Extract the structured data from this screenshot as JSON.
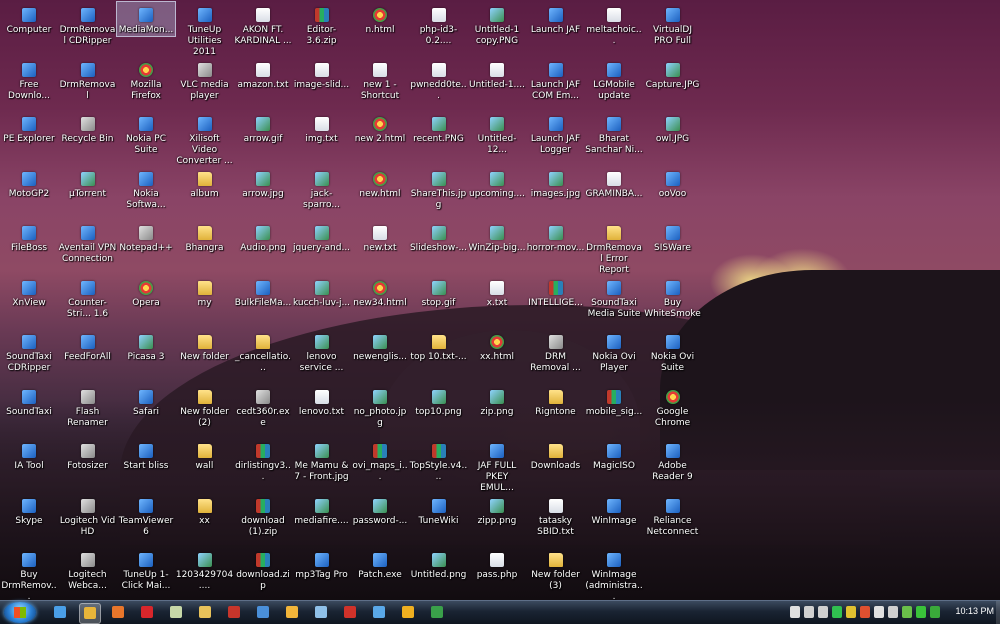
{
  "desktop": {
    "icons": [
      {
        "label": "Computer",
        "icon": "computer-icon",
        "type": "app"
      },
      {
        "label": "DrmRemoval CDRipper",
        "icon": "app-icon",
        "type": "app"
      },
      {
        "label": "MediaMon...",
        "icon": "app-icon",
        "type": "app",
        "selected": true
      },
      {
        "label": "TuneUp Utilities 2011",
        "icon": "tuneup-icon",
        "type": "app"
      },
      {
        "label": "AKON FT. KARDINAL ...",
        "icon": "music-icon",
        "type": "doc"
      },
      {
        "label": "Editor-3.6.zip",
        "icon": "zip-icon",
        "type": "zip"
      },
      {
        "label": "n.html",
        "icon": "chrome-html-icon",
        "type": "web"
      },
      {
        "label": "php-id3-0.2....",
        "icon": "file-icon",
        "type": "doc"
      },
      {
        "label": "Untitled-1 copy.PNG",
        "icon": "image-icon",
        "type": "img"
      },
      {
        "label": "Launch JAF",
        "icon": "app-icon",
        "type": "app"
      },
      {
        "label": "meltachoic...",
        "icon": "file-icon",
        "type": "doc"
      },
      {
        "label": "VirtualDJ PRO Full",
        "icon": "app-icon",
        "type": "app"
      },
      {
        "label": "Free Downlo...",
        "icon": "app-icon",
        "type": "app"
      },
      {
        "label": "DrmRemoval",
        "icon": "app-icon",
        "type": "app"
      },
      {
        "label": "Mozilla Firefox",
        "icon": "firefox-icon",
        "type": "web"
      },
      {
        "label": "VLC media player",
        "icon": "vlc-icon",
        "type": "exe"
      },
      {
        "label": "amazon.txt",
        "icon": "text-file-icon",
        "type": "doc"
      },
      {
        "label": "image-slid...",
        "icon": "file-icon",
        "type": "doc"
      },
      {
        "label": "new 1 - Shortcut",
        "icon": "shortcut-icon",
        "type": "doc"
      },
      {
        "label": "pwnedd0te...",
        "icon": "file-icon",
        "type": "doc"
      },
      {
        "label": "Untitled-1....",
        "icon": "file-icon",
        "type": "doc"
      },
      {
        "label": "Launch JAF COM Em...",
        "icon": "app-icon",
        "type": "app"
      },
      {
        "label": "LGMobile update",
        "icon": "app-icon",
        "type": "app"
      },
      {
        "label": "Capture.JPG",
        "icon": "image-icon",
        "type": "img"
      },
      {
        "label": "PE Explorer",
        "icon": "app-icon",
        "type": "app"
      },
      {
        "label": "Recycle Bin",
        "icon": "recycle-bin-icon",
        "type": "exe"
      },
      {
        "label": "Nokia PC Suite",
        "icon": "app-icon",
        "type": "app"
      },
      {
        "label": "Xilisoft Video Converter ...",
        "icon": "app-icon",
        "type": "app"
      },
      {
        "label": "arrow.gif",
        "icon": "image-icon",
        "type": "img"
      },
      {
        "label": "img.txt",
        "icon": "text-file-icon",
        "type": "doc"
      },
      {
        "label": "new 2.html",
        "icon": "chrome-html-icon",
        "type": "web"
      },
      {
        "label": "recent.PNG",
        "icon": "image-icon",
        "type": "img"
      },
      {
        "label": "Untitled-12...",
        "icon": "image-icon",
        "type": "img"
      },
      {
        "label": "Launch JAF Logger",
        "icon": "app-icon",
        "type": "app"
      },
      {
        "label": "Bharat Sanchar Ni...",
        "icon": "app-icon",
        "type": "app"
      },
      {
        "label": "owl.JPG",
        "icon": "image-icon",
        "type": "img"
      },
      {
        "label": "MotoGP2",
        "icon": "app-icon",
        "type": "app"
      },
      {
        "label": "µTorrent",
        "icon": "utorrent-icon",
        "type": "img"
      },
      {
        "label": "Nokia Softwa...",
        "icon": "app-icon",
        "type": "app"
      },
      {
        "label": "album",
        "icon": "folder-icon",
        "type": "folder"
      },
      {
        "label": "arrow.jpg",
        "icon": "image-icon",
        "type": "img"
      },
      {
        "label": "jack-sparro...",
        "icon": "image-icon",
        "type": "img"
      },
      {
        "label": "new.html",
        "icon": "chrome-html-icon",
        "type": "web"
      },
      {
        "label": "ShareThis.jpg",
        "icon": "image-icon",
        "type": "img"
      },
      {
        "label": "upcoming....",
        "icon": "image-icon",
        "type": "img"
      },
      {
        "label": "images.jpg",
        "icon": "image-icon",
        "type": "img"
      },
      {
        "label": "GRAMINBA...",
        "icon": "file-icon",
        "type": "doc"
      },
      {
        "label": "ooVoo",
        "icon": "oovoo-icon",
        "type": "app"
      },
      {
        "label": "FileBoss",
        "icon": "app-icon",
        "type": "app"
      },
      {
        "label": "Aventail VPN Connection",
        "icon": "app-icon",
        "type": "app"
      },
      {
        "label": "Notepad++",
        "icon": "notepad-icon",
        "type": "exe"
      },
      {
        "label": "Bhangra",
        "icon": "folder-icon",
        "type": "folder"
      },
      {
        "label": "Audio.png",
        "icon": "image-icon",
        "type": "img"
      },
      {
        "label": "jquery-and...",
        "icon": "image-icon",
        "type": "img"
      },
      {
        "label": "new.txt",
        "icon": "text-file-icon",
        "type": "doc"
      },
      {
        "label": "Slideshow-...",
        "icon": "image-icon",
        "type": "img"
      },
      {
        "label": "WinZip-big...",
        "icon": "image-icon",
        "type": "img"
      },
      {
        "label": "horror-mov...",
        "icon": "image-icon",
        "type": "img"
      },
      {
        "label": "DrmRemoval Error Report",
        "icon": "folder-icon",
        "type": "folder"
      },
      {
        "label": "SISWare",
        "icon": "app-icon",
        "type": "app"
      },
      {
        "label": "XnView",
        "icon": "app-icon",
        "type": "app"
      },
      {
        "label": "Counter-Stri... 1.6",
        "icon": "app-icon",
        "type": "app"
      },
      {
        "label": "Opera",
        "icon": "opera-icon",
        "type": "web"
      },
      {
        "label": "my",
        "icon": "folder-icon",
        "type": "folder"
      },
      {
        "label": "BulkFileMa...",
        "icon": "app-icon",
        "type": "app"
      },
      {
        "label": "kucch-luv-j...",
        "icon": "image-icon",
        "type": "img"
      },
      {
        "label": "new34.html",
        "icon": "chrome-html-icon",
        "type": "web"
      },
      {
        "label": "stop.gif",
        "icon": "image-icon",
        "type": "img"
      },
      {
        "label": "x.txt",
        "icon": "text-file-icon",
        "type": "doc"
      },
      {
        "label": "INTELLIGE...",
        "icon": "zip-icon",
        "type": "zip"
      },
      {
        "label": "SoundTaxi Media Suite",
        "icon": "app-icon",
        "type": "app"
      },
      {
        "label": "Buy WhiteSmoke",
        "icon": "ie-icon",
        "type": "app"
      },
      {
        "label": "SoundTaxi CDRipper",
        "icon": "app-icon",
        "type": "app"
      },
      {
        "label": "FeedForAll",
        "icon": "app-icon",
        "type": "app"
      },
      {
        "label": "Picasa 3",
        "icon": "picasa-icon",
        "type": "img"
      },
      {
        "label": "New folder",
        "icon": "folder-icon",
        "type": "folder"
      },
      {
        "label": "_cancellatio...",
        "icon": "folder-icon",
        "type": "folder"
      },
      {
        "label": "lenovo service ...",
        "icon": "image-icon",
        "type": "img"
      },
      {
        "label": "newenglis...",
        "icon": "image-icon",
        "type": "img"
      },
      {
        "label": "top 10.txt-...",
        "icon": "folder-icon",
        "type": "folder"
      },
      {
        "label": "xx.html",
        "icon": "chrome-html-icon",
        "type": "web"
      },
      {
        "label": "DRM Removal ...",
        "icon": "app-icon",
        "type": "exe"
      },
      {
        "label": "Nokia Ovi Player",
        "icon": "app-icon",
        "type": "app"
      },
      {
        "label": "Nokia Ovi Suite",
        "icon": "app-icon",
        "type": "app"
      },
      {
        "label": "SoundTaxi",
        "icon": "app-icon",
        "type": "app"
      },
      {
        "label": "Flash Renamer",
        "icon": "app-icon",
        "type": "exe"
      },
      {
        "label": "Safari",
        "icon": "safari-icon",
        "type": "app"
      },
      {
        "label": "New folder (2)",
        "icon": "folder-icon",
        "type": "folder"
      },
      {
        "label": "cedt360r.exe",
        "icon": "app-icon",
        "type": "exe"
      },
      {
        "label": "lenovo.txt",
        "icon": "text-file-icon",
        "type": "doc"
      },
      {
        "label": "no_photo.jpg",
        "icon": "image-icon",
        "type": "img"
      },
      {
        "label": "top10.png",
        "icon": "image-icon",
        "type": "img"
      },
      {
        "label": "zip.png",
        "icon": "image-icon",
        "type": "img"
      },
      {
        "label": "Rigntone",
        "icon": "folder-icon",
        "type": "folder"
      },
      {
        "label": "mobile_sig...",
        "icon": "zip-icon",
        "type": "zip"
      },
      {
        "label": "Google Chrome",
        "icon": "chrome-icon",
        "type": "web"
      },
      {
        "label": "IA Tool",
        "icon": "app-icon",
        "type": "app"
      },
      {
        "label": "Fotosizer",
        "icon": "app-icon",
        "type": "exe"
      },
      {
        "label": "Start bliss",
        "icon": "app-icon",
        "type": "app"
      },
      {
        "label": "wall",
        "icon": "folder-icon",
        "type": "folder"
      },
      {
        "label": "dirlistingv3...",
        "icon": "zip-icon",
        "type": "zip"
      },
      {
        "label": "Me Mamu & 7 - Front.jpg",
        "icon": "image-icon",
        "type": "img"
      },
      {
        "label": "ovi_maps_i...",
        "icon": "zip-icon",
        "type": "zip"
      },
      {
        "label": "TopStyle.v4....",
        "icon": "zip-icon",
        "type": "zip"
      },
      {
        "label": "JAF FULL PKEY EMUL...",
        "icon": "app-icon",
        "type": "app"
      },
      {
        "label": "Downloads",
        "icon": "folder-icon",
        "type": "folder"
      },
      {
        "label": "MagicISO",
        "icon": "app-icon",
        "type": "app"
      },
      {
        "label": "Adobe Reader 9",
        "icon": "adobe-reader-icon",
        "type": "app"
      },
      {
        "label": "Skype",
        "icon": "skype-icon",
        "type": "app"
      },
      {
        "label": "Logitech Vid HD",
        "icon": "app-icon",
        "type": "exe"
      },
      {
        "label": "TeamViewer 6",
        "icon": "teamviewer-icon",
        "type": "app"
      },
      {
        "label": "xx",
        "icon": "folder-icon",
        "type": "folder"
      },
      {
        "label": "download (1).zip",
        "icon": "zip-icon",
        "type": "zip"
      },
      {
        "label": "mediafire....",
        "icon": "image-icon",
        "type": "img"
      },
      {
        "label": "password-...",
        "icon": "image-icon",
        "type": "img"
      },
      {
        "label": "TuneWiki",
        "icon": "app-icon",
        "type": "app"
      },
      {
        "label": "zipp.png",
        "icon": "image-icon",
        "type": "img"
      },
      {
        "label": "tatasky SBID.txt",
        "icon": "text-file-icon",
        "type": "doc"
      },
      {
        "label": "WinImage",
        "icon": "app-icon",
        "type": "app"
      },
      {
        "label": "Reliance Netconnect",
        "icon": "app-icon",
        "type": "app"
      },
      {
        "label": "Buy DrmRemov...",
        "icon": "app-icon",
        "type": "app"
      },
      {
        "label": "Logitech Webca...",
        "icon": "app-icon",
        "type": "exe"
      },
      {
        "label": "TuneUp 1-Click Mai...",
        "icon": "tuneup-icon",
        "type": "app"
      },
      {
        "label": "1203429704....",
        "icon": "image-icon",
        "type": "img"
      },
      {
        "label": "download.zip",
        "icon": "zip-icon",
        "type": "zip"
      },
      {
        "label": "mp3Tag Pro",
        "icon": "app-icon",
        "type": "app"
      },
      {
        "label": "Patch.exe",
        "icon": "app-icon",
        "type": "app"
      },
      {
        "label": "Untitled.png",
        "icon": "image-icon",
        "type": "img"
      },
      {
        "label": "pass.php",
        "icon": "file-icon",
        "type": "doc"
      },
      {
        "label": "New folder (3)",
        "icon": "folder-icon",
        "type": "folder"
      },
      {
        "label": "WinImage (administra...",
        "icon": "app-icon",
        "type": "app"
      }
    ]
  },
  "taskbar": {
    "start_label": "Start",
    "pinned": [
      {
        "name": "internet-explorer-icon",
        "color": "#4a9fe8"
      },
      {
        "name": "chrome-icon",
        "color": "#e8b53a",
        "active": true
      },
      {
        "name": "firefox-icon",
        "color": "#e8762b"
      },
      {
        "name": "opera-icon",
        "color": "#d9262b"
      },
      {
        "name": "notepad-icon",
        "color": "#c7d8a8"
      },
      {
        "name": "folder-icon",
        "color": "#e8c25a"
      },
      {
        "name": "filezilla-icon",
        "color": "#c8352b"
      },
      {
        "name": "app-icon",
        "color": "#4a8fd9"
      },
      {
        "name": "media-player-icon",
        "color": "#f2b53a"
      },
      {
        "name": "notepad-icon",
        "color": "#8fc0e8"
      },
      {
        "name": "adobe-reader-icon",
        "color": "#d1322a"
      },
      {
        "name": "document-icon",
        "color": "#5aa8e8"
      },
      {
        "name": "winamp-icon",
        "color": "#f0b020"
      },
      {
        "name": "app-icon",
        "color": "#3aa04a"
      }
    ],
    "tray": [
      {
        "name": "network-badge-icon",
        "color": "#3aa93a"
      },
      {
        "name": "skype-icon",
        "color": "#3ac23a"
      },
      {
        "name": "utorrent-icon",
        "color": "#6ac04a"
      },
      {
        "name": "network-icon",
        "color": "#d0d0d0"
      },
      {
        "name": "flag-icon",
        "color": "#e0e0e0"
      },
      {
        "name": "windows-icon",
        "color": "#e05030"
      },
      {
        "name": "key-icon",
        "color": "#e0c030"
      },
      {
        "name": "sync-icon",
        "color": "#30c050"
      },
      {
        "name": "usb-icon",
        "color": "#d0d0d0"
      },
      {
        "name": "power-icon",
        "color": "#d0d0d0"
      },
      {
        "name": "volume-icon",
        "color": "#e0e0e0"
      }
    ],
    "clock": "10:13 PM"
  }
}
